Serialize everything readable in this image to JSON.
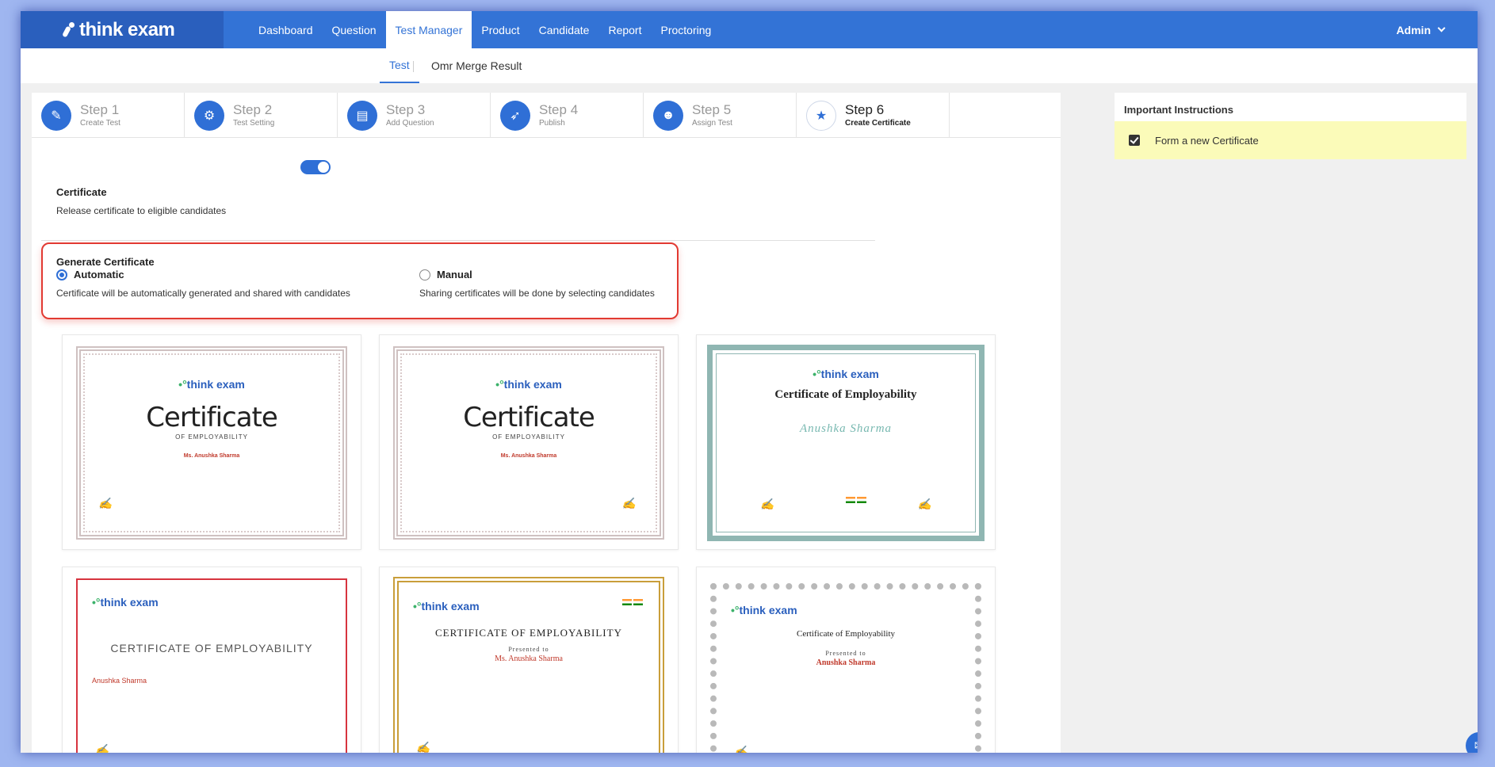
{
  "brand": {
    "name": "think exam"
  },
  "topnav": {
    "items": [
      {
        "label": "Dashboard"
      },
      {
        "label": "Question"
      },
      {
        "label": "Test Manager"
      },
      {
        "label": "Product"
      },
      {
        "label": "Candidate"
      },
      {
        "label": "Report"
      },
      {
        "label": "Proctoring"
      }
    ],
    "active": "Test Manager",
    "user": "Admin"
  },
  "subnav": {
    "tabs": [
      {
        "label": "Test"
      },
      {
        "label": "Omr Merge Result"
      }
    ],
    "active": "Test"
  },
  "steps": [
    {
      "title": "Step 1",
      "sub": "Create Test",
      "icon": "pencil-icon"
    },
    {
      "title": "Step 2",
      "sub": "Test Setting",
      "icon": "gear-icon"
    },
    {
      "title": "Step 3",
      "sub": "Add Question",
      "icon": "document-icon"
    },
    {
      "title": "Step 4",
      "sub": "Publish",
      "icon": "rocket-icon"
    },
    {
      "title": "Step 5",
      "sub": "Assign Test",
      "icon": "users-icon"
    },
    {
      "title": "Step 6",
      "sub": "Create Certificate",
      "icon": "star-icon"
    }
  ],
  "certificate": {
    "heading": "Certificate",
    "description": "Release certificate to eligible candidates",
    "enabled": true
  },
  "generate": {
    "heading": "Generate Certificate",
    "automatic": {
      "label": "Automatic",
      "desc": "Certificate will be automatically generated and shared with candidates",
      "selected": true
    },
    "manual": {
      "label": "Manual",
      "desc": "Sharing certificates will be done by selecting candidates",
      "selected": false
    }
  },
  "templates": {
    "logo": "think exam",
    "t1": {
      "title": "Certificate",
      "subtitle": "OF EMPLOYABILITY",
      "name": "Ms. Anushka Sharma"
    },
    "t2": {
      "title": "Certificate",
      "subtitle": "OF EMPLOYABILITY",
      "name": "Ms. Anushka Sharma"
    },
    "t3": {
      "title": "Certificate of Employability",
      "name": "Anushka Sharma"
    },
    "t4": {
      "title": "CERTIFICATE OF EMPLOYABILITY",
      "name": "Anushka Sharma"
    },
    "t5": {
      "title": "CERTIFICATE OF EMPLOYABILITY",
      "presented": "Presented to",
      "name": "Ms. Anushka Sharma"
    },
    "t6": {
      "title": "Certificate of Employability",
      "presented": "Presented to",
      "name": "Anushka Sharma"
    }
  },
  "instructions": {
    "title": "Important Instructions",
    "items": [
      {
        "label": "Form a new Certificate",
        "checked": true
      }
    ]
  },
  "colors": {
    "primary": "#3373d6",
    "highlight": "#fbfbb9",
    "alert": "#e23a32"
  }
}
